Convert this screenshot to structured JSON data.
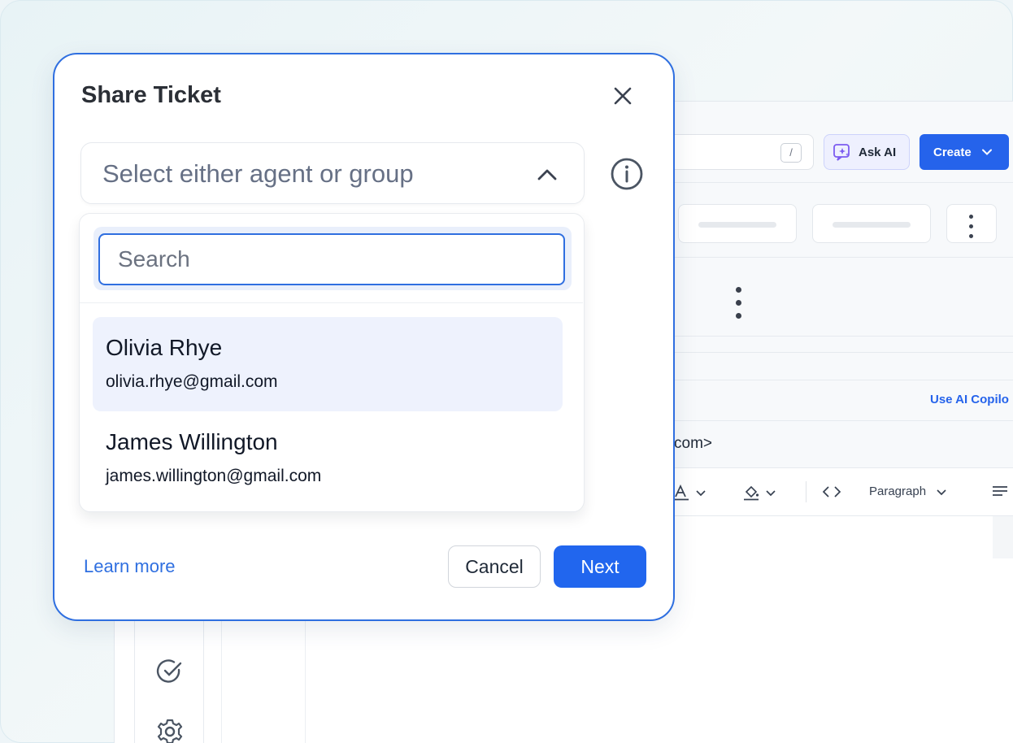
{
  "modal": {
    "title": "Share Ticket",
    "select_placeholder": "Select either agent or group",
    "search_placeholder": "Search",
    "options": [
      {
        "name": "Olivia Rhye",
        "email": "olivia.rhye@gmail.com",
        "highlighted": true
      },
      {
        "name": "James Willington",
        "email": "james.willington@gmail.com",
        "highlighted": false
      }
    ],
    "learn_more": "Learn more",
    "cancel_label": "Cancel",
    "next_label": "Next"
  },
  "background": {
    "search_shortcut": "/",
    "ask_ai_label": "Ask AI",
    "create_label": "Create",
    "use_ai_copilot": "Use AI Copilo",
    "email_fragment": "com>",
    "paragraph_label": "Paragraph"
  },
  "colors": {
    "accent": "#2166ee",
    "modal_border": "#2f6fe0",
    "highlight": "#eef2fd",
    "backdrop": "#eef5f8"
  }
}
